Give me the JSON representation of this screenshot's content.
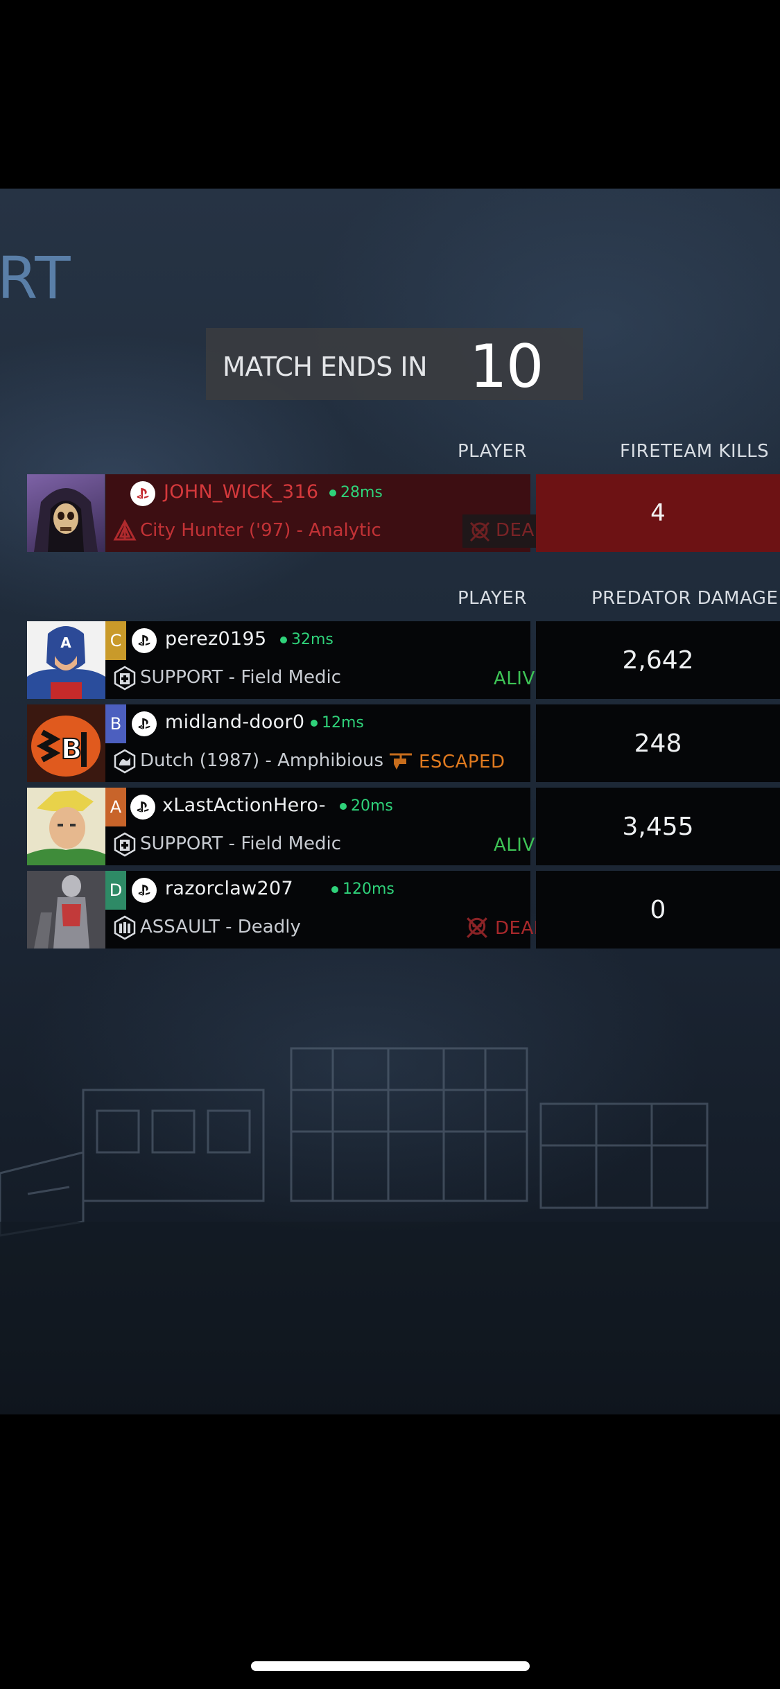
{
  "mode_title": "RT",
  "timer": {
    "label": "MATCH ENDS IN",
    "value": "10"
  },
  "fireteam": {
    "col_player": "PLAYER",
    "col_value": "FIRETEAM KILLS",
    "player": {
      "name": "JOHN_WICK_316",
      "ping": "28ms",
      "class": "City Hunter ('97) - Analytic",
      "status": "DEAD",
      "value": "4"
    }
  },
  "squad": {
    "col_player": "PLAYER",
    "col_value": "PREDATOR DAMAGE",
    "players": [
      {
        "letter": "C",
        "name": "perez0195",
        "ping": "32ms",
        "class": "SUPPORT - Field Medic",
        "status": "ALIVE",
        "value": "2,642"
      },
      {
        "letter": "B",
        "name": "midland-door0",
        "ping": "12ms",
        "class": "Dutch (1987) - Amphibious",
        "status": "ESCAPED",
        "value": "248"
      },
      {
        "letter": "A",
        "name": "xLastActionHero-",
        "ping": "20ms",
        "class": "SUPPORT - Field Medic",
        "status": "ALIVE",
        "value": "3,455"
      },
      {
        "letter": "D",
        "name": "razorclaw207",
        "ping": "120ms",
        "class": "ASSAULT - Deadly",
        "status": "DEAD",
        "value": "0"
      }
    ]
  },
  "colors": {
    "fireteam_red": "#6d1214",
    "alive_green": "#3ec456",
    "escaped_orange": "#e07a1f",
    "dead_red": "#a8282b",
    "ping_green": "#2fd27a",
    "letter_C": "#c99a2a",
    "letter_B": "#4c5fbf",
    "letter_A": "#c8642a",
    "letter_D": "#2e8a66"
  }
}
